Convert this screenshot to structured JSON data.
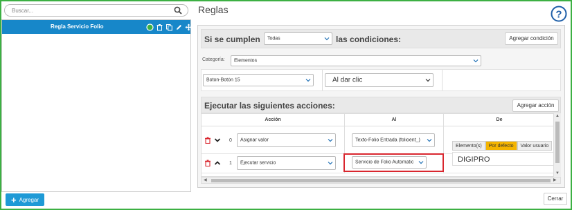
{
  "search": {
    "placeholder": "Buscar..."
  },
  "rules": [
    {
      "label": "Regla Servicio Folio"
    }
  ],
  "add_button": {
    "label": "Agregar"
  },
  "page_title": "Reglas",
  "conditions": {
    "title_prefix": "Si se cumplen",
    "match_value": "Todas",
    "title_suffix": "las condiciones:",
    "add_label": "Agregar condición",
    "category_label": "Categoría:",
    "category_value": "Elementos",
    "element_value": "Boton-Botón 15",
    "event_value": "Al dar clic"
  },
  "actions": {
    "title": "Ejecutar las siguientes acciones:",
    "add_label": "Agregar acción",
    "columns": [
      "Acción",
      "Al",
      "De"
    ],
    "rows": [
      {
        "index": "0",
        "action": "Asignar valor",
        "target": "Texto-Folio Entrada (folioent_)"
      },
      {
        "index": "1",
        "action": "Ejecutar servicio",
        "target": "Servicio de Folio Automatic"
      }
    ],
    "source_tabs": [
      "Elemento(s)",
      "Por defecto",
      "Valor usuario"
    ],
    "source_value": "DIGIPRO"
  },
  "close_button": {
    "label": "Cerrar"
  },
  "colors": {
    "accent": "#1787c9",
    "border": "#3cb043",
    "highlight": "#d9262e",
    "active_tab": "#f4b400"
  }
}
